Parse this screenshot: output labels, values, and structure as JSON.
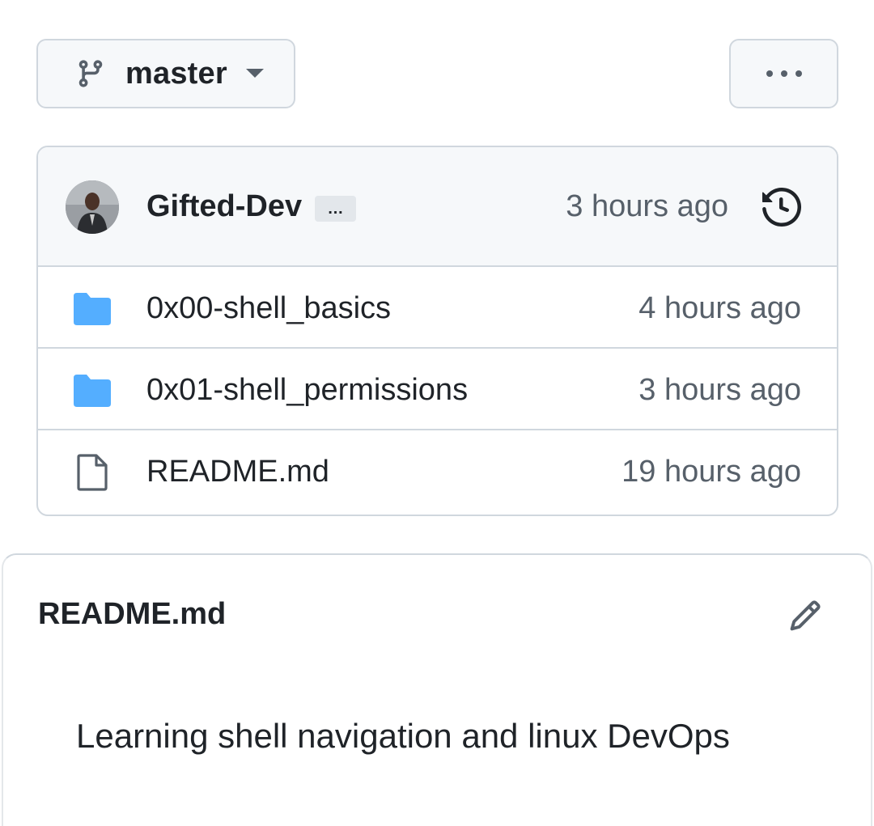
{
  "branch": {
    "name": "master",
    "icon": "git-branch-icon"
  },
  "more_menu": {
    "icon": "kebab-horizontal-icon"
  },
  "commit": {
    "author": "Gifted-Dev",
    "ellipsis": "…",
    "time": "3 hours ago",
    "history_icon": "history-icon"
  },
  "files": [
    {
      "type": "folder",
      "name": "0x00-shell_basics",
      "time": "4 hours ago"
    },
    {
      "type": "folder",
      "name": "0x01-shell_permissions",
      "time": "3 hours ago"
    },
    {
      "type": "file",
      "name": "README.md",
      "time": "19 hours ago"
    }
  ],
  "readme": {
    "title": "README.md",
    "edit_icon": "pencil-icon",
    "body": "Learning shell navigation and linux DevOps"
  },
  "colors": {
    "folder": "#54aeff",
    "border": "#d0d7de",
    "muted_text": "#57606a",
    "header_bg": "#f6f8fa"
  }
}
